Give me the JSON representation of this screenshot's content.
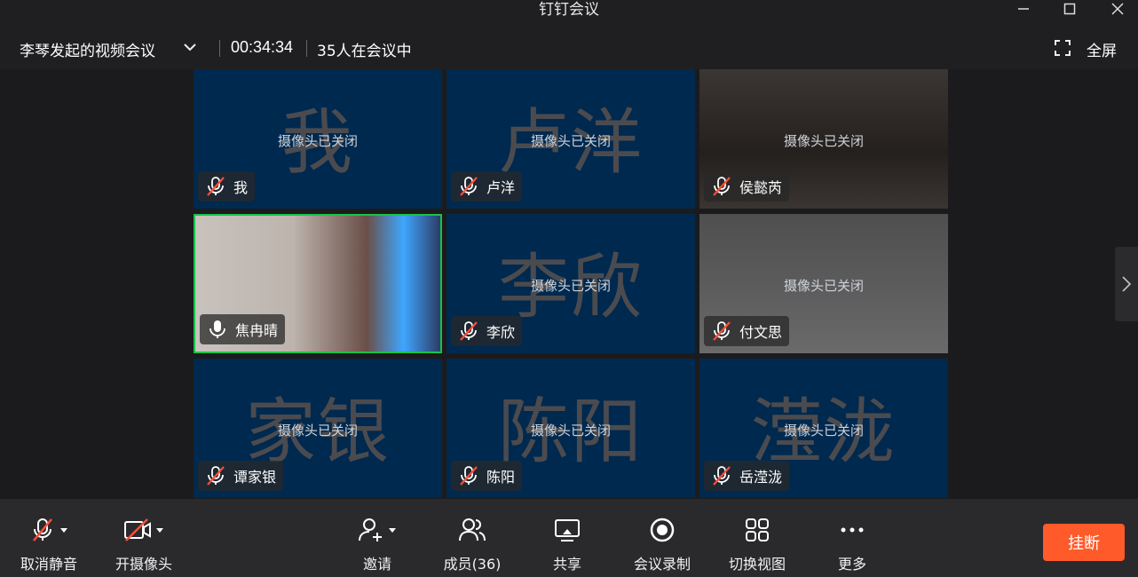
{
  "window": {
    "title": "钉钉会议"
  },
  "info": {
    "host_title": "李琴发起的视频会议",
    "elapsed": "00:34:34",
    "participants": "35人在会议中",
    "fullscreen_label": "全屏"
  },
  "camera_off_text": "摄像头已关闭",
  "tiles": [
    {
      "display_name": "我",
      "big_text": "我",
      "mic": "muted",
      "style": "avatar"
    },
    {
      "display_name": "卢洋",
      "big_text": "卢洋",
      "mic": "muted",
      "style": "avatar"
    },
    {
      "display_name": "侯懿芮",
      "big_text": "",
      "mic": "muted",
      "style": "photo1"
    },
    {
      "display_name": "焦冉晴",
      "big_text": "",
      "mic": "on",
      "style": "live"
    },
    {
      "display_name": "李欣",
      "big_text": "李欣",
      "mic": "muted",
      "style": "avatar"
    },
    {
      "display_name": "付文思",
      "big_text": "",
      "mic": "muted",
      "style": "photo2"
    },
    {
      "display_name": "谭家银",
      "big_text": "家银",
      "mic": "muted",
      "style": "avatar"
    },
    {
      "display_name": "陈阳",
      "big_text": "陈阳",
      "mic": "muted",
      "style": "avatar"
    },
    {
      "display_name": "岳滢泷",
      "big_text": "滢泷",
      "mic": "muted",
      "style": "avatar"
    }
  ],
  "toolbar": {
    "unmute": "取消静音",
    "camera": "开摄像头",
    "invite": "邀请",
    "members": "成员(36)",
    "share": "共享",
    "record": "会议录制",
    "view": "切换视图",
    "more": "更多",
    "hangup": "挂断"
  },
  "colors": {
    "accent_hangup": "#ff5a29",
    "tile_bg": "#00294f",
    "active_border": "#19c24b"
  }
}
